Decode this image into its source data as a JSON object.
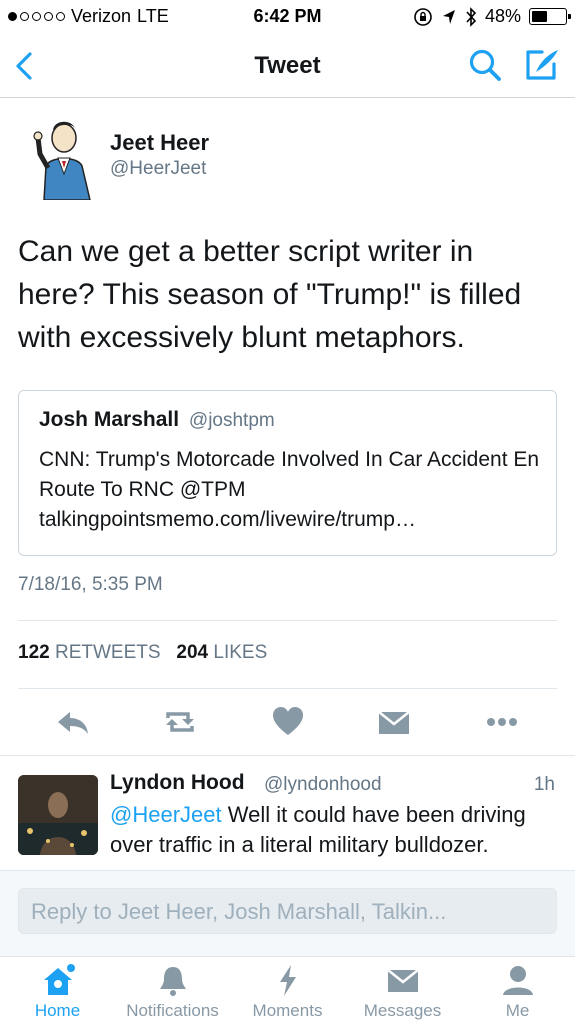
{
  "status_bar": {
    "carrier": "Verizon",
    "network": "LTE",
    "time": "6:42 PM",
    "battery": "48%",
    "battery_level": 0.48
  },
  "nav": {
    "title": "Tweet",
    "back_icon": "chevron-left-icon",
    "search_icon": "search-icon",
    "compose_icon": "compose-icon"
  },
  "tweet": {
    "author_name": "Jeet Heer",
    "author_handle": "@HeerJeet",
    "text": "Can we get a better script writer in here? This season of \"Trump!\" is filled with excessively blunt metaphors.",
    "quote": {
      "name": "Josh Marshall",
      "handle": "@joshtpm",
      "text": "CNN: Trump's Motorcade Involved In Car Accident En Route To RNC @TPM talkingpointsmemo.com/livewire/trump…"
    },
    "timestamp": "7/18/16, 5:35 PM",
    "retweets_count": "122",
    "retweets_label": "RETWEETS",
    "likes_count": "204",
    "likes_label": "LIKES"
  },
  "actions": [
    "reply-icon",
    "retweet-icon",
    "heart-icon",
    "direct-message-icon",
    "more-icon"
  ],
  "reply": {
    "name": "Lyndon Hood",
    "handle": "@lyndonhood",
    "time": "1h",
    "mention": "@HeerJeet",
    "text": " Well it could have been driving over traffic in a literal military bulldozer."
  },
  "composer": {
    "placeholder": "Reply to Jeet Heer, Josh Marshall, Talkin..."
  },
  "tabs": [
    {
      "label": "Home",
      "icon": "home-icon",
      "active": true
    },
    {
      "label": "Notifications",
      "icon": "bell-icon",
      "active": false
    },
    {
      "label": "Moments",
      "icon": "lightning-icon",
      "active": false
    },
    {
      "label": "Messages",
      "icon": "envelope-icon",
      "active": false
    },
    {
      "label": "Me",
      "icon": "person-icon",
      "active": false
    }
  ],
  "colors": {
    "accent": "#1da1f2",
    "muted": "#657786",
    "icon_gray": "#8899a6",
    "text": "#14171a"
  }
}
